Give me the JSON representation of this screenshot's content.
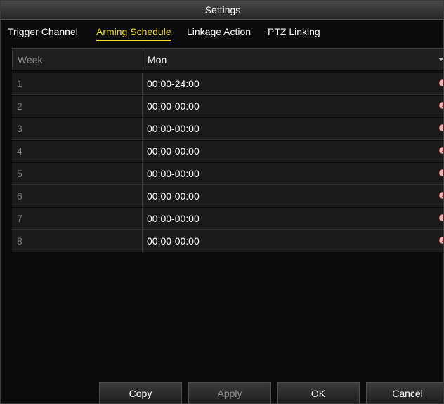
{
  "window": {
    "title": "Settings"
  },
  "tabs": [
    {
      "label": "Trigger Channel",
      "active": false
    },
    {
      "label": "Arming Schedule",
      "active": true
    },
    {
      "label": "Linkage Action",
      "active": false
    },
    {
      "label": "PTZ Linking",
      "active": false
    }
  ],
  "schedule": {
    "week_label": "Week",
    "week_value": "Mon",
    "rows": [
      {
        "index": "1",
        "time": "00:00-24:00"
      },
      {
        "index": "2",
        "time": "00:00-00:00"
      },
      {
        "index": "3",
        "time": "00:00-00:00"
      },
      {
        "index": "4",
        "time": "00:00-00:00"
      },
      {
        "index": "5",
        "time": "00:00-00:00"
      },
      {
        "index": "6",
        "time": "00:00-00:00"
      },
      {
        "index": "7",
        "time": "00:00-00:00"
      },
      {
        "index": "8",
        "time": "00:00-00:00"
      }
    ]
  },
  "footer": {
    "copy_label": "Copy",
    "apply_label": "Apply",
    "ok_label": "OK",
    "cancel_label": "Cancel"
  },
  "colors": {
    "active_tab": "#f3df2a",
    "clock_icon": "#f2b3b3"
  },
  "icons": {
    "time_edit": "clock-icon",
    "dropdown": "chevron-down-icon"
  }
}
